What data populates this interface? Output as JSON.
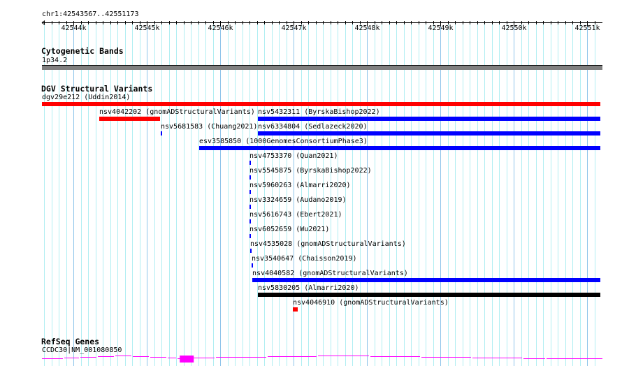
{
  "view": {
    "chrom": "chr1",
    "start": 42543567,
    "end": 42551173,
    "location_label": "chr1:42543567..42551173"
  },
  "ruler": {
    "ticks": [
      "42544k",
      "42545k",
      "42546k",
      "42547k",
      "42548k",
      "42549k",
      "42550k",
      "42551k"
    ],
    "tick_values": [
      42544000,
      42545000,
      42546000,
      42547000,
      42548000,
      42549000,
      42550000,
      42551000
    ]
  },
  "cytobands": {
    "title": "Cytogenetic Bands",
    "band": "1p34.2",
    "color": "#808080"
  },
  "dgv": {
    "title": "DGV Structural Variants",
    "features": [
      {
        "label": "dgv29e212 (Uddin2014)",
        "start": 42543567,
        "end": 42551173,
        "color": "#ff0000",
        "row": 0
      },
      {
        "label": "nsv4042202 (gnomADStructuralVariants)",
        "start": 42544348,
        "end": 42545177,
        "color": "#ff0000",
        "row": 1
      },
      {
        "label": "nsv5432311 (ByrskaBishop2022)",
        "start": 42546510,
        "end": 42551173,
        "color": "#0000ff",
        "row": 1
      },
      {
        "label": "nsv5681583 (Chuang2021)",
        "start": 42545186,
        "end": 42545200,
        "color": "#0000ff",
        "row": 2
      },
      {
        "label": "nsv6334804 (Sedlazeck2020)",
        "start": 42546510,
        "end": 42551173,
        "color": "#0000ff",
        "row": 2
      },
      {
        "label": "esv3585850 (1000GenomesConsortiumPhase3)",
        "start": 42545710,
        "end": 42551173,
        "color": "#0000ff",
        "row": 3
      },
      {
        "label": "nsv4753370 (Quan2021)",
        "start": 42546396,
        "end": 42546410,
        "color": "#0000ff",
        "row": 4
      },
      {
        "label": "nsv5545875 (ByrskaBishop2022)",
        "start": 42546396,
        "end": 42546410,
        "color": "#0000ff",
        "row": 5
      },
      {
        "label": "nsv5960263 (Almarri2020)",
        "start": 42546396,
        "end": 42546410,
        "color": "#0000ff",
        "row": 6
      },
      {
        "label": "nsv3324659 (Audano2019)",
        "start": 42546396,
        "end": 42546410,
        "color": "#0000ff",
        "row": 7
      },
      {
        "label": "nsv5616743 (Ebert2021)",
        "start": 42546396,
        "end": 42546410,
        "color": "#0000ff",
        "row": 8
      },
      {
        "label": "nsv6052659 (Wu2021)",
        "start": 42546396,
        "end": 42546410,
        "color": "#0000ff",
        "row": 9
      },
      {
        "label": "nsv4535028 (gnomADStructuralVariants)",
        "start": 42546405,
        "end": 42546419,
        "color": "#0000ff",
        "row": 10
      },
      {
        "label": "nsv3540647 (Chaisson2019)",
        "start": 42546424,
        "end": 42546438,
        "color": "#0000ff",
        "row": 11
      },
      {
        "label": "nsv4040582 (gnomADStructuralVariants)",
        "start": 42546434,
        "end": 42551173,
        "color": "#0000ff",
        "row": 12
      },
      {
        "label": "nsv5830205 (Almarri2020)",
        "start": 42546510,
        "end": 42551173,
        "color": "#000000",
        "row": 13
      },
      {
        "label": "nsv4046910 (gnomADStructuralVariants)",
        "start": 42546986,
        "end": 42547053,
        "color": "#ff0000",
        "row": 14
      }
    ]
  },
  "refseq": {
    "title": "RefSeq Genes",
    "gene_label": "CCDC30|NM_001080850",
    "color": "#ff00ff",
    "exon": {
      "start": 42545445,
      "end": 42545636
    }
  }
}
